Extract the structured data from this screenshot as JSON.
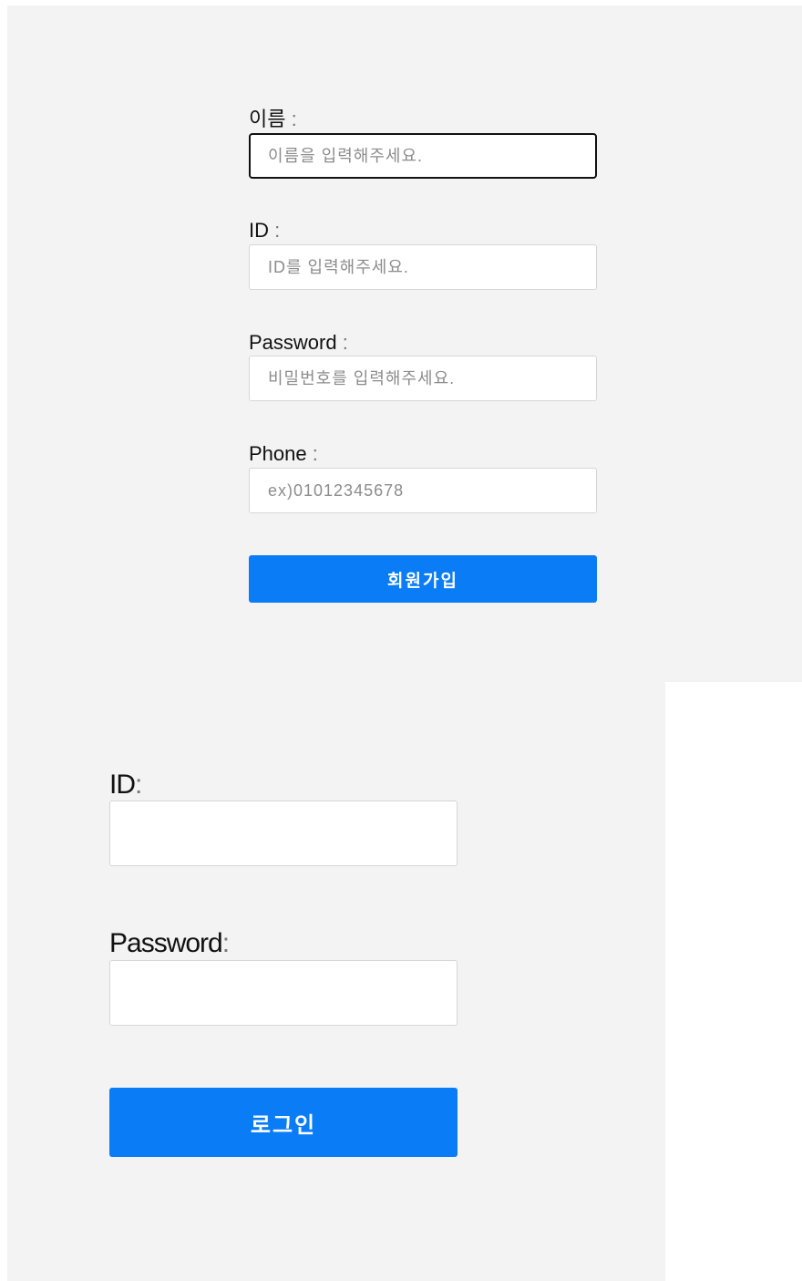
{
  "signup_form": {
    "name": {
      "label": "이름",
      "separator": " :",
      "placeholder": "이름을 입력해주세요."
    },
    "id": {
      "label": "ID",
      "separator": " :",
      "placeholder": "ID를 입력해주세요."
    },
    "password": {
      "label": "Password",
      "separator": " :",
      "placeholder": "비밀번호를 입력해주세요."
    },
    "phone": {
      "label": "Phone",
      "separator": " :",
      "placeholder": "ex)01012345678"
    },
    "submit_label": "회원가입"
  },
  "login_form": {
    "id": {
      "label": "ID",
      "separator": ":",
      "value": ""
    },
    "password": {
      "label": "Password",
      "separator": ":",
      "value": ""
    },
    "submit_label": "로그인"
  },
  "colors": {
    "panel_background": "#f3f3f3",
    "primary_button": "#0a7cf5",
    "focused_border": "#111111"
  }
}
